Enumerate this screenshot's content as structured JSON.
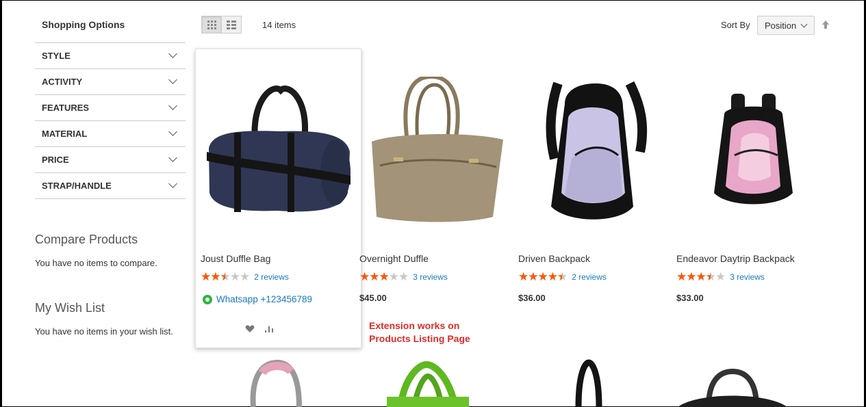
{
  "sidebar": {
    "title": "Shopping Options",
    "filters": [
      "STYLE",
      "ACTIVITY",
      "FEATURES",
      "MATERIAL",
      "PRICE",
      "STRAP/HANDLE"
    ],
    "compare_title": "Compare Products",
    "compare_text": "You have no items to compare.",
    "wishlist_title": "My Wish List",
    "wishlist_text": "You have no items in your wish list."
  },
  "toolbar": {
    "item_count": "14 items",
    "sort_label": "Sort By",
    "sort_value": "Position",
    "view_modes": [
      "grid-icon",
      "list-icon"
    ],
    "sort_direction_icon": "arrow-up-icon"
  },
  "products": [
    {
      "name": "Joust Duffle Bag",
      "rating": 2.5,
      "reviews": "2 reviews",
      "price": ""
    },
    {
      "name": "Overnight Duffle",
      "rating": 3,
      "reviews": "3 reviews",
      "price": "$45.00"
    },
    {
      "name": "Driven Backpack",
      "rating": 4.5,
      "reviews": "2 reviews",
      "price": "$36.00"
    },
    {
      "name": "Endeavor Daytrip Backpack",
      "rating": 3.5,
      "reviews": "3 reviews",
      "price": "$33.00"
    }
  ],
  "whatsapp": {
    "label": "Whatsapp +123456789",
    "icon": "whatsapp-icon"
  },
  "card_actions": [
    "heart-icon",
    "compare-icon"
  ],
  "annotation": {
    "line1": "Extension works on",
    "line2": "Products Listing Page"
  },
  "colors": {
    "accent_link": "#1979c3",
    "star": "#ff5501",
    "annotation": "#e02b27",
    "whatsapp": "#2bb741"
  }
}
